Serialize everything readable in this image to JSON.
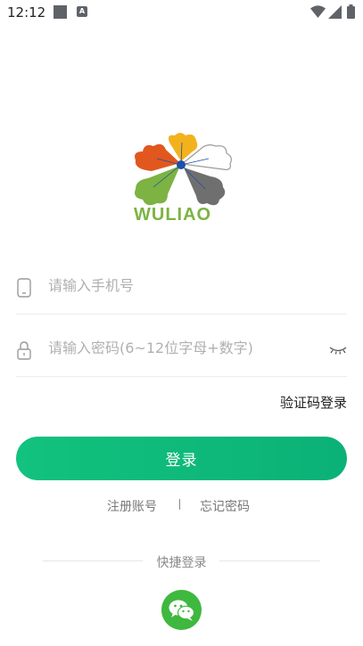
{
  "status_bar": {
    "time": "12:12",
    "a_badge": "A"
  },
  "logo": {
    "text": "WULIAO",
    "text_color": "#7cb342"
  },
  "form": {
    "phone_placeholder": "请输入手机号",
    "password_placeholder": "请输入密码(6~12位字母+数字)",
    "code_login": "验证码登录",
    "login_button": "登录"
  },
  "links": {
    "register": "注册账号",
    "forgot": "忘记密码"
  },
  "quick_login": {
    "label": "快捷登录"
  },
  "colors": {
    "accent": "#0fbb7a",
    "wechat": "#3fb83f"
  }
}
